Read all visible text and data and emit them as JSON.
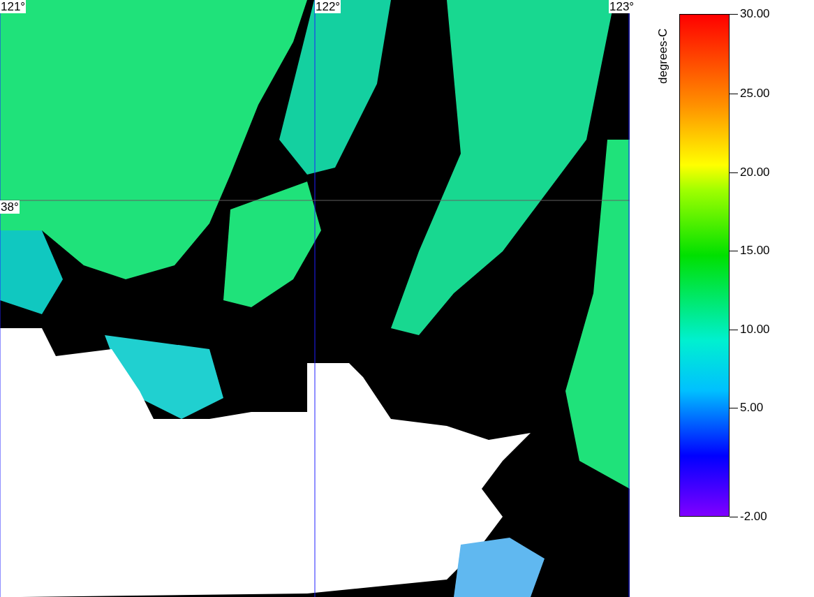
{
  "map": {
    "lon_labels": [
      "121°",
      "122°",
      "123°"
    ],
    "lat_labels": [
      "38°"
    ]
  },
  "colorbar": {
    "title": "degrees-C",
    "ticks": [
      "30.00",
      "25.00",
      "20.00",
      "15.00",
      "10.00",
      "5.00",
      "-2.00"
    ]
  }
}
